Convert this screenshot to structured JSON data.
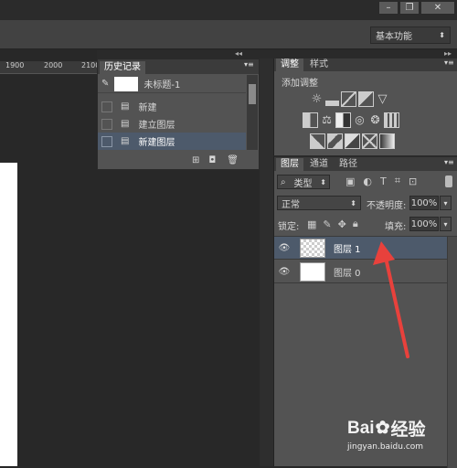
{
  "window": {
    "min_label": "–",
    "restore_label": "❐",
    "close_label": "✕"
  },
  "workspace": {
    "selected": "基本功能"
  },
  "ruler": {
    "labels": [
      "1900",
      "2000",
      "2100"
    ]
  },
  "history": {
    "tab_label": "历史记录",
    "snapshot_label": "未标题-1",
    "items": [
      {
        "label": "新建",
        "selected": false
      },
      {
        "label": "建立图层",
        "selected": false
      },
      {
        "label": "新建图层",
        "selected": true
      }
    ]
  },
  "adjustments": {
    "tabs": [
      "调整",
      "样式"
    ],
    "add_label": "添加调整",
    "row1": [
      "brightness-icon",
      "levels-icon",
      "curves-icon",
      "exposure-icon",
      "gradient-triangle-icon"
    ],
    "row2": [
      "vibrance-icon",
      "balance-icon",
      "black-white-icon",
      "photo-filter-icon",
      "channel-mixer-icon",
      "color-lookup-icon"
    ],
    "row3": [
      "invert-icon",
      "posterize-icon",
      "threshold-icon",
      "selective-color-icon",
      "gradient-map-icon"
    ]
  },
  "layers": {
    "tabs": [
      "图层",
      "通道",
      "路径"
    ],
    "filter_label": "类型",
    "blend_mode": "正常",
    "opacity_label": "不透明度:",
    "opacity_value": "100%",
    "lock_label": "锁定:",
    "fill_label": "填充:",
    "fill_value": "100%",
    "items": [
      {
        "name": "图层 1",
        "selected": true,
        "transparent": true
      },
      {
        "name": "图层 0",
        "selected": false,
        "transparent": false
      }
    ]
  },
  "watermark": {
    "brand": "Bai",
    "brand2": "经验",
    "url": "jingyan.baidu.com"
  },
  "colors": {
    "selected_row": "#4d5a6b",
    "arrow": "#e8413c",
    "panel": "#535353"
  }
}
